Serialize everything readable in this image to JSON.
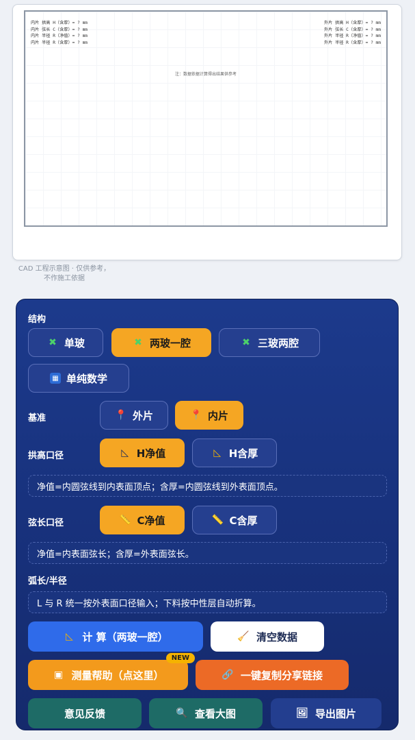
{
  "cad": {
    "left_lines": [
      "内片 拱高 H（含厚）= ? mm",
      "内片 弦长 C（含厚）= ? mm",
      "内片 半径 R（净值）= ? mm",
      "内片 半径 R（含厚）= ? mm"
    ],
    "right_lines": [
      "外片 拱高 H（含厚）= ? mm",
      "外片 弦长 C（含厚）= ? mm",
      "外片 半径 R（净值）= ? mm",
      "外片 半径 R（含厚）= ? mm"
    ],
    "note": "注：数据依据计算得出结果供参考",
    "caption": "CAD 工程示意图 · 仅供参考，不作施工依据"
  },
  "panel": {
    "structure_label": "结构",
    "structure_options": [
      "单玻",
      "两玻一腔",
      "三玻两腔",
      "单纯数学"
    ],
    "basis_label": "基准",
    "basis_options": [
      "外片",
      "内片"
    ],
    "arch_label": "拱高口径",
    "arch_options": [
      "H净值",
      "H含厚"
    ],
    "arch_note": "净值=内圆弦线到内表面顶点；含厚=内圆弦线到外表面顶点。",
    "chord_label": "弦长口径",
    "chord_options": [
      "C净值",
      "C含厚"
    ],
    "chord_note": "净值=内表面弦长；含厚=外表面弦长。",
    "arc_label": "弧长/半径",
    "arc_note": "L 与 R 统一按外表面口径输入；下料按中性层自动折算。",
    "calc_label": "计 算（两玻一腔）",
    "clear_label": "清空数据",
    "help_label": "测量帮助（点这里）",
    "new_badge": "NEW",
    "share_label": "一键复制分享链接",
    "feedback_label": "意见反馈",
    "bigview_label": "查看大图",
    "export_label": "导出图片"
  },
  "colors": {
    "accent": "#f5a623",
    "panel": "#1c3a8c",
    "calc": "#2f6bea"
  }
}
